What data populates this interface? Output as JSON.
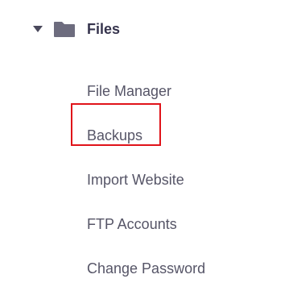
{
  "section": {
    "title": "Files",
    "expanded": true,
    "icon": "folder-icon",
    "caret_icon": "caret-down-icon"
  },
  "menu": {
    "items": [
      {
        "label": "File Manager"
      },
      {
        "label": "Backups",
        "highlighted": true
      },
      {
        "label": "Import Website"
      },
      {
        "label": "FTP Accounts"
      },
      {
        "label": "Change Password"
      }
    ]
  },
  "colors": {
    "title_text": "#36344d",
    "item_text": "#565567",
    "icon_fill": "#6d6c7e",
    "highlight_border": "#e0131a"
  }
}
